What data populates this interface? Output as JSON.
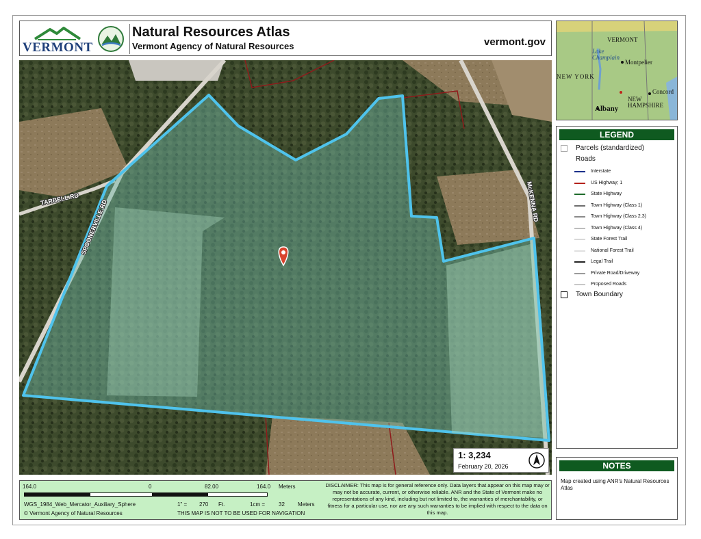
{
  "header": {
    "logo_text": "VERMONT",
    "title": "Natural Resources Atlas",
    "agency": "Vermont Agency of Natural Resources",
    "url": "vermont.gov"
  },
  "map": {
    "road_labels": [
      "TARBELL RD",
      "SPOONERVILLE RD",
      "McKENNA RD"
    ],
    "scale_ratio": "1: 3,234",
    "date": "February 20, 2026",
    "north_arrow": "north-arrow-icon"
  },
  "inset": {
    "labels": [
      "VERMONT",
      "Lake Champlain",
      "Montpelier",
      "NEW YORK",
      "Concord",
      "NEW HAMPSHIRE",
      "Albany"
    ]
  },
  "legend": {
    "title": "LEGEND",
    "parcels": "Parcels (standardized)",
    "roads": "Roads",
    "road_items": [
      {
        "label": "Interstate",
        "color": "#1a2f8a"
      },
      {
        "label": "US Highway; 1",
        "color": "#b5221b"
      },
      {
        "label": "State Highway",
        "color": "#1d6a2a"
      },
      {
        "label": "Town Highway (Class 1)",
        "color": "#6d6d6d"
      },
      {
        "label": "Town Highway (Class 2,3)",
        "color": "#8a8a8a"
      },
      {
        "label": "Town Highway (Class 4)",
        "color": "#bdbdbd"
      },
      {
        "label": "State Forest Trail",
        "color": "#d8d8d8"
      },
      {
        "label": "National Forest Trail",
        "color": "#e0e0e0"
      },
      {
        "label": "Legal Trail",
        "color": "#222222"
      },
      {
        "label": "Private Road/Driveway",
        "color": "#9a9a9a"
      },
      {
        "label": "Proposed Roads",
        "color": "#c8c8c8"
      }
    ],
    "town_boundary": "Town Boundary"
  },
  "notes": {
    "title": "NOTES",
    "text": "Map created using ANR's Natural Resources Atlas"
  },
  "footer": {
    "scale_labels": [
      "164.0",
      "0",
      "82.00",
      "164.0"
    ],
    "scale_unit": "Meters",
    "projection": "WGS_1984_Web_Mercator_Auxiliary_Sphere",
    "copyright": "© Vermont Agency of Natural Resources",
    "inch_label": "1\" =",
    "inch_value": "270",
    "inch_unit": "Ft.",
    "cm_label": "1cm =",
    "cm_value": "32",
    "cm_unit": "Meters",
    "nav_warning": "THIS MAP IS NOT TO BE USED FOR NAVIGATION",
    "disclaimer": "DISCLAIMER: This map is for general reference only. Data layers that appear on this map may or may not be accurate, current, or otherwise reliable. ANR and the State of Vermont make no representations of any kind, including but not limited to, the warranties of merchantability, or fitness for a particular use, nor are any such warranties to be implied with respect to the data on this map."
  },
  "colors": {
    "parcel_outline": "#4fc3ec",
    "legend_header": "#0f5a20",
    "footer_bg": "#c6f0c4",
    "pin": "#d9442e"
  }
}
